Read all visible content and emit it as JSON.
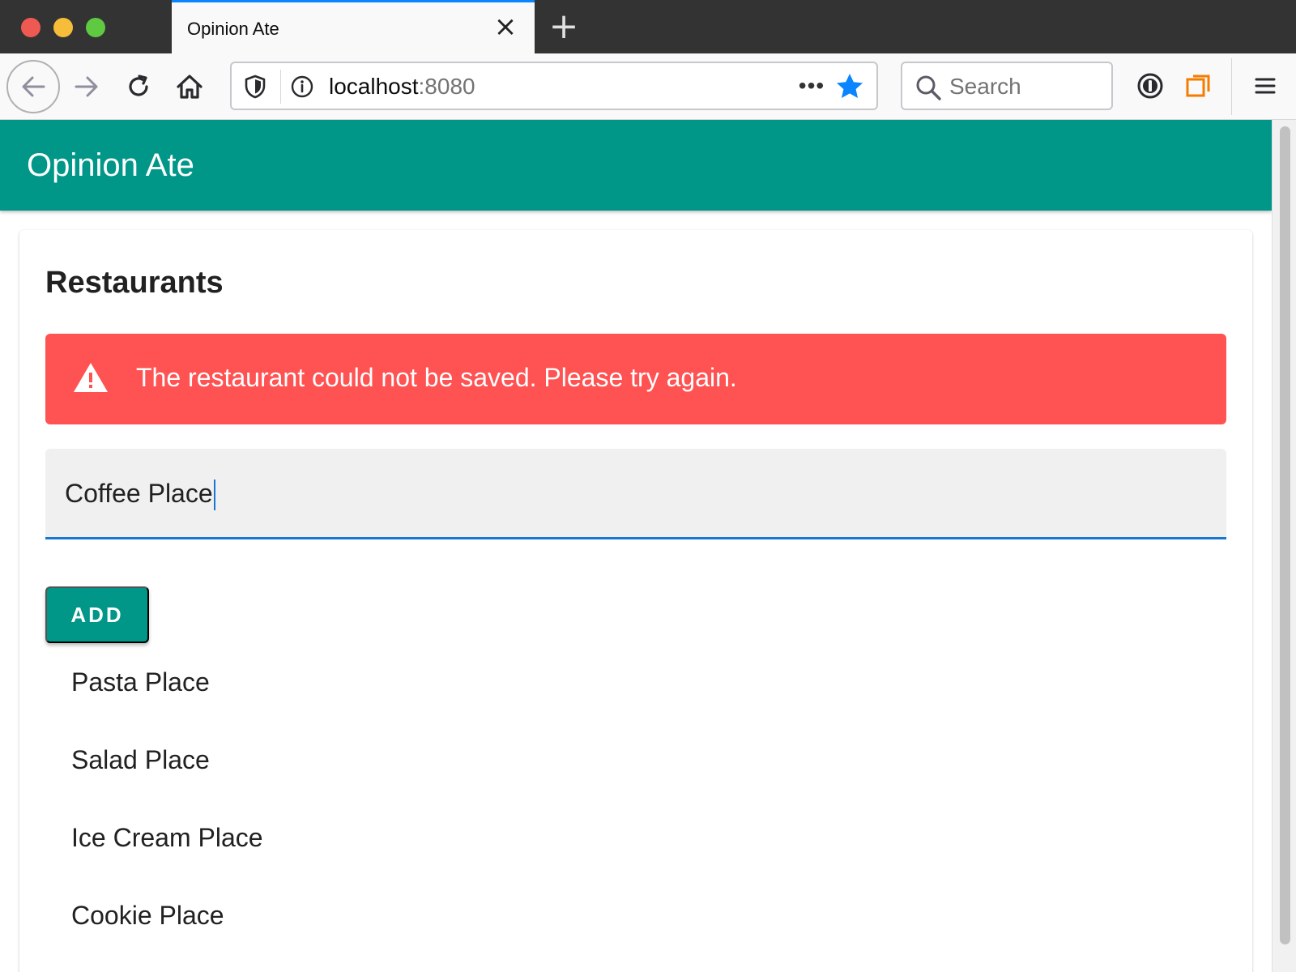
{
  "browser": {
    "tab": {
      "title": "Opinion Ate",
      "close_label": "×"
    },
    "new_tab_label": "+",
    "url": {
      "host": "localhost",
      "port": ":8080"
    },
    "url_menu_label": "•••",
    "search": {
      "placeholder": "Search"
    },
    "colors": {
      "accent": "#0a84ff",
      "tabstrip": "#333333"
    },
    "icons": [
      "back-arrow-icon",
      "forward-arrow-icon",
      "reload-icon",
      "home-icon",
      "shield-icon",
      "info-icon",
      "bookmark-star-icon",
      "search-icon",
      "password-manager-icon",
      "container-icon",
      "hamburger-menu-icon"
    ]
  },
  "app": {
    "title": "Opinion Ate",
    "colors": {
      "primary": "#009688",
      "error": "#ff5252",
      "focus": "#1976d2"
    }
  },
  "restaurants": {
    "heading": "Restaurants",
    "error_message": "The restaurant could not be saved. Please try again.",
    "name_input_value": "Coffee Place",
    "add_button_label": "ADD",
    "items": [
      "Pasta Place",
      "Salad Place",
      "Ice Cream Place",
      "Cookie Place"
    ]
  }
}
